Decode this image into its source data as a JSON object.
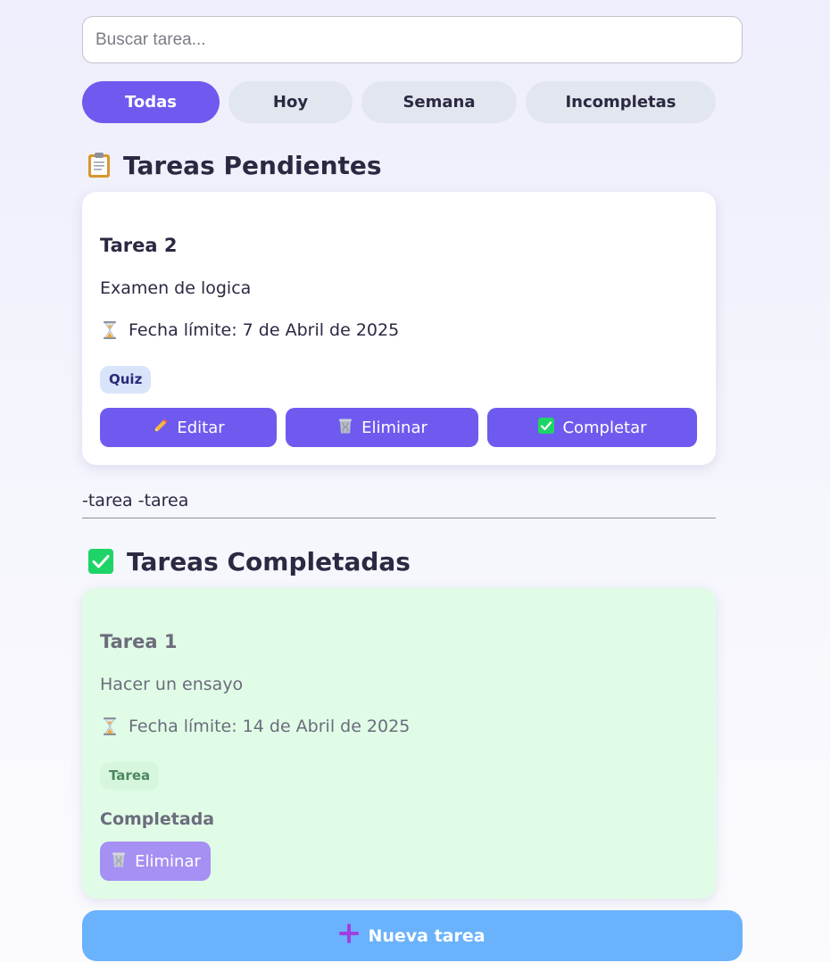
{
  "search": {
    "placeholder": "Buscar tarea...",
    "value": ""
  },
  "filters": [
    {
      "label": "Todas",
      "active": true
    },
    {
      "label": "Hoy",
      "active": false
    },
    {
      "label": "Semana",
      "active": false
    },
    {
      "label": "Incompletas",
      "active": false
    }
  ],
  "pending": {
    "title": "Tareas Pendientes",
    "icon": "clipboard-icon",
    "tasks": [
      {
        "title": "Tarea 2",
        "description": "Examen de logica",
        "deadline": "Fecha límite: 7 de Abril de 2025",
        "tag": "Quiz",
        "actions": {
          "edit": "Editar",
          "delete": "Eliminar",
          "complete": "Completar"
        }
      }
    ]
  },
  "note_input": {
    "value": "-tarea -tarea"
  },
  "completed": {
    "title": "Tareas Completadas",
    "icon": "check-box-icon",
    "tasks": [
      {
        "title": "Tarea 1",
        "description": "Hacer un ensayo",
        "deadline": "Fecha límite: 14 de Abril de 2025",
        "tag": "Tarea",
        "status": "Completada",
        "actions": {
          "delete": "Eliminar"
        }
      }
    ]
  },
  "new_task_button": {
    "label": "Nueva tarea"
  },
  "colors": {
    "accent": "#6f5aef",
    "accent_faded": "#a690f3",
    "filter_inactive": "#e2e6ef",
    "completed_card": "#e0fce6",
    "new_task": "#6ab2fc",
    "check_green": "#1fd466"
  }
}
